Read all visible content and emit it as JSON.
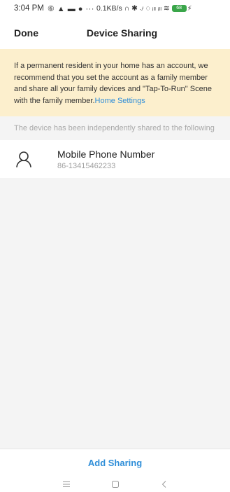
{
  "status_bar": {
    "time": "3:04 PM",
    "icons": "⑥ ▲ ▬ ● ···",
    "speed": "0.1KB/s",
    "right_icons": "∩ ✱ ⍻ ◌ ᵢₗₗ ᵢₗₗ ≋",
    "battery": "68",
    "charging": "⚡"
  },
  "nav": {
    "done_label": "Done",
    "title": "Device Sharing"
  },
  "notice": {
    "text": "If a permanent resident in your home has an account, we recommend that you set the account as a family member and share all your family devices and \"Tap-To-Run\" Scene with the family member.",
    "link": "Home Settings"
  },
  "caption": "The device has been independently shared to the following",
  "shares": [
    {
      "name": "Mobile Phone Number",
      "phone": "86-13415462233"
    }
  ],
  "footer": {
    "add_sharing_label": "Add Sharing"
  },
  "system_nav": {
    "menu_icon": "menu-icon",
    "home_icon": "home-icon",
    "back_icon": "back-icon"
  },
  "colors": {
    "accent": "#2f8ed8",
    "notice_bg": "#fcefcd",
    "page_bg": "#f4f4f4"
  }
}
